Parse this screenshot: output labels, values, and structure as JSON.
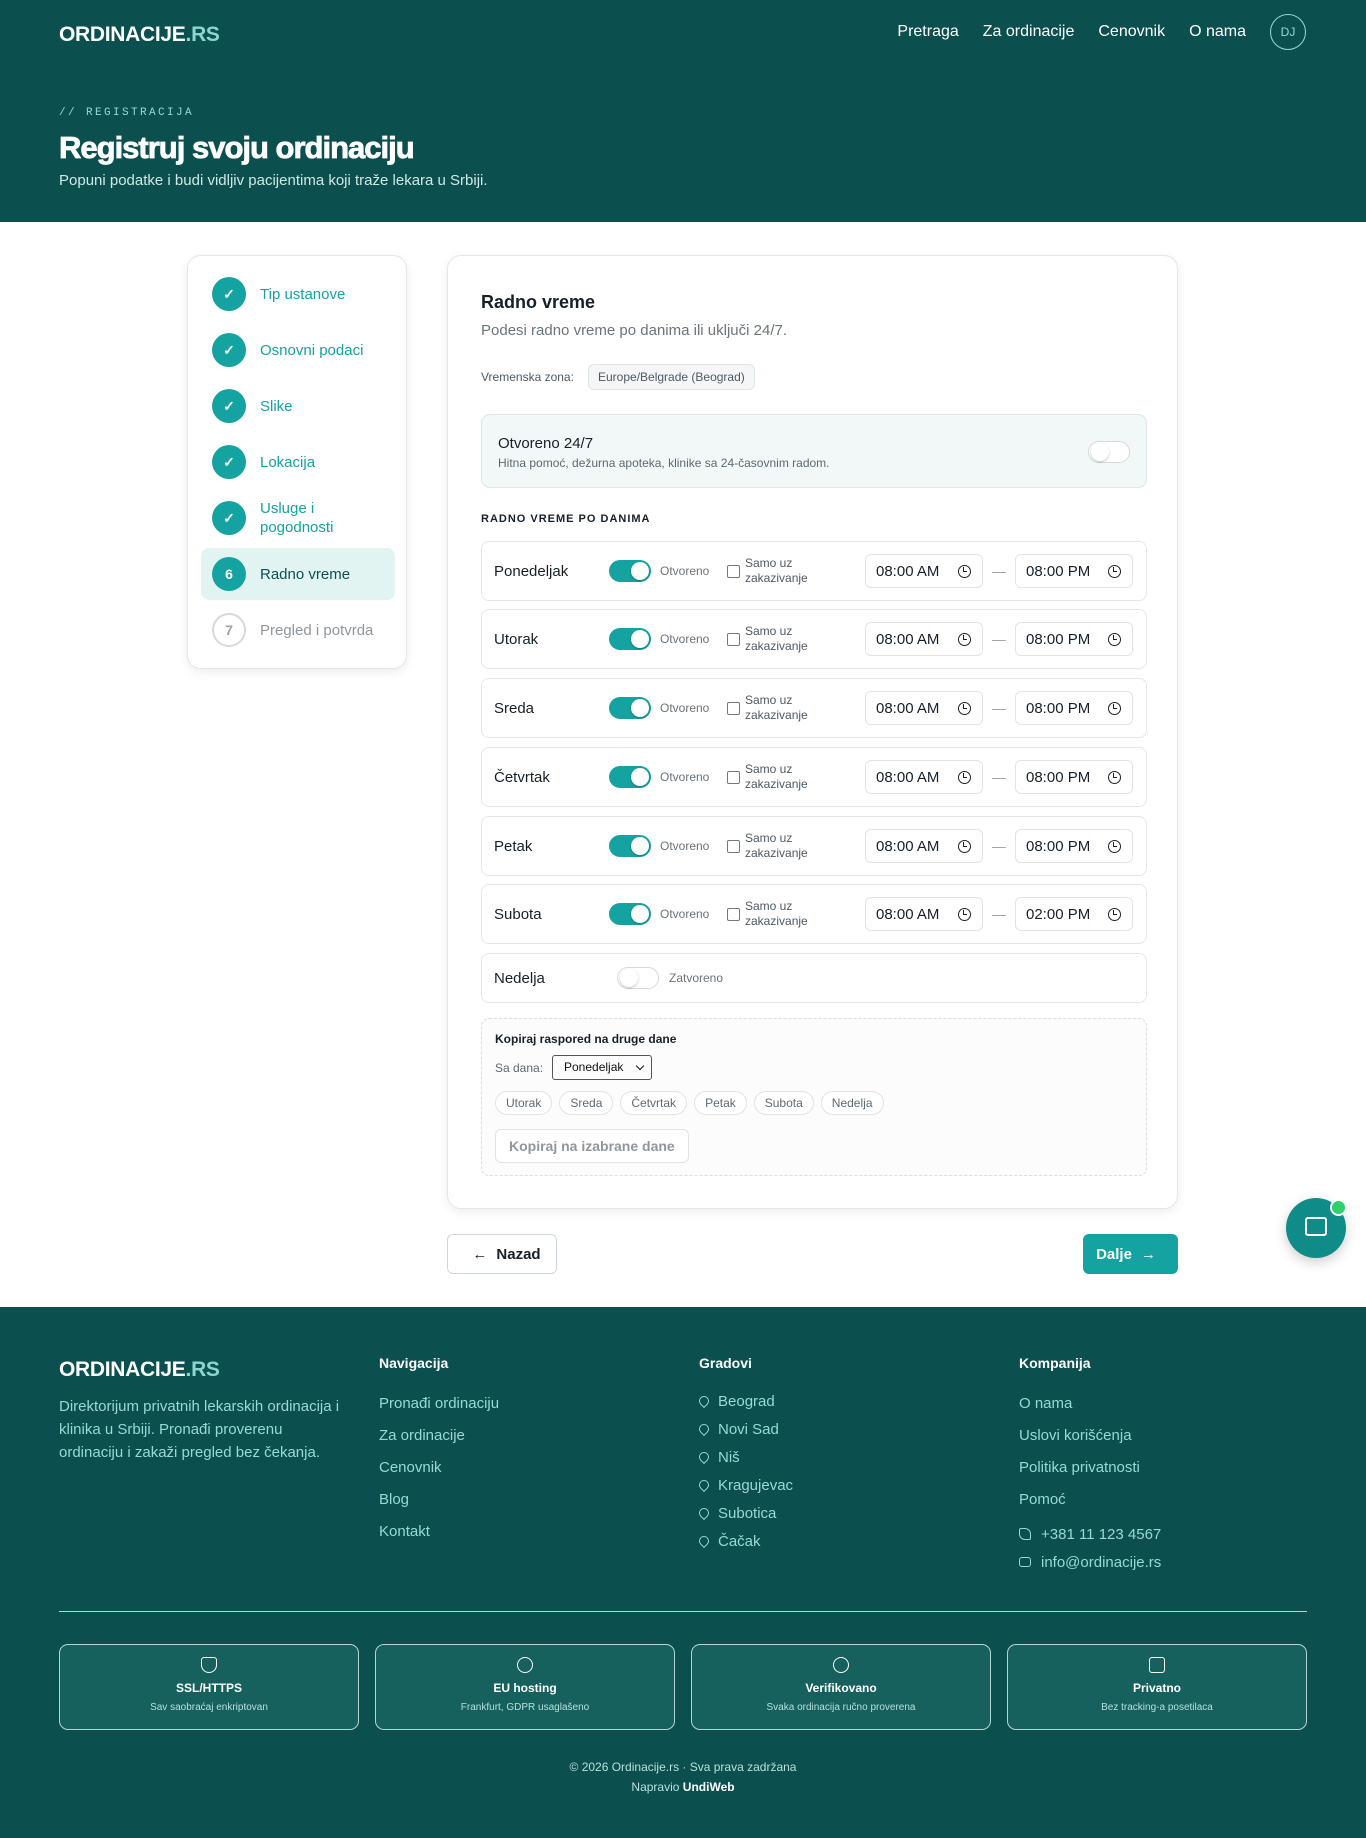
{
  "brand": {
    "name": "ORDINACIJE",
    "suffix": ".RS"
  },
  "nav": {
    "items": [
      "Pretraga",
      "Za ordinacije",
      "Cenovnik",
      "O nama"
    ],
    "avatar": "DJ"
  },
  "hero": {
    "kicker": "// REGISTRACIJA",
    "title": "Registruj svoju ordinaciju",
    "subtitle": "Popuni podatke i budi vidljiv pacijentima koji traže lekara u Srbiji."
  },
  "steps": [
    {
      "label": "Tip ustanove",
      "status": "done",
      "marker": "✓"
    },
    {
      "label": "Osnovni podaci",
      "status": "done",
      "marker": "✓"
    },
    {
      "label": "Slike",
      "status": "done",
      "marker": "✓"
    },
    {
      "label": "Lokacija",
      "status": "done",
      "marker": "✓"
    },
    {
      "label": "Usluge i pogodnosti",
      "status": "done",
      "marker": "✓"
    },
    {
      "label": "Radno vreme",
      "status": "active",
      "marker": "6"
    },
    {
      "label": "Pregled i potvrda",
      "status": "pending",
      "marker": "7"
    }
  ],
  "form": {
    "title": "Radno vreme",
    "subtitle": "Podesi radno vreme po danima ili uključi 24/7.",
    "timezone_label": "Vremenska zona:",
    "timezone_value": "Europe/Belgrade (Beograd)",
    "open247": {
      "title": "Otvoreno 24/7",
      "desc": "Hitna pomoć, dežurna apoteka, klinike sa 24-časovnim radom.",
      "enabled": false
    },
    "section_title": "RADNO VREME PO DANIMA",
    "open_label": "Otvoreno",
    "closed_label": "Zatvoreno",
    "appointment_label": "Samo uz zakazivanje",
    "days": [
      {
        "name": "Ponedeljak",
        "open": true,
        "from": "08:00 AM",
        "to": "08:00 PM"
      },
      {
        "name": "Utorak",
        "open": true,
        "from": "08:00 AM",
        "to": "08:00 PM"
      },
      {
        "name": "Sreda",
        "open": true,
        "from": "08:00 AM",
        "to": "08:00 PM"
      },
      {
        "name": "Četvrtak",
        "open": true,
        "from": "08:00 AM",
        "to": "08:00 PM"
      },
      {
        "name": "Petak",
        "open": true,
        "from": "08:00 AM",
        "to": "08:00 PM"
      },
      {
        "name": "Subota",
        "open": true,
        "from": "08:00 AM",
        "to": "02:00 PM"
      },
      {
        "name": "Nedelja",
        "open": false
      }
    ],
    "copy": {
      "title": "Kopiraj raspored na druge dane",
      "from_label": "Sa dana:",
      "from_value": "Ponedeljak",
      "targets": [
        "Utorak",
        "Sreda",
        "Četvrtak",
        "Petak",
        "Subota",
        "Nedelja"
      ],
      "button": "Kopiraj na izabrane dane"
    }
  },
  "actions": {
    "back": "Nazad",
    "next": "Dalje"
  },
  "footer": {
    "description": "Direktorijum privatnih lekarskih ordinacija i klinika u Srbiji. Pronađi proverenu ordinaciju i zakaži pregled bez čekanja.",
    "navigation": {
      "title": "Navigacija",
      "links": [
        "Pronađi ordinaciju",
        "Za ordinacije",
        "Cenovnik",
        "Blog",
        "Kontakt"
      ]
    },
    "cities": {
      "title": "Gradovi",
      "links": [
        "Beograd",
        "Novi Sad",
        "Niš",
        "Kragujevac",
        "Subotica",
        "Čačak"
      ]
    },
    "company": {
      "title": "Kompanija",
      "links": [
        "O nama",
        "Uslovi korišćenja",
        "Politika privatnosti",
        "Pomoć"
      ],
      "phone": "+381 11 123 4567",
      "email": "info@ordinacije.rs"
    },
    "badges": [
      {
        "title": "SSL/HTTPS",
        "desc": "Sav saobraćaj enkriptovan",
        "icon": "shield-icon"
      },
      {
        "title": "EU hosting",
        "desc": "Frankfurt, GDPR usaglašeno",
        "icon": "globe-icon"
      },
      {
        "title": "Verifikovano",
        "desc": "Svaka ordinacija ručno proverena",
        "icon": "check-circle-icon"
      },
      {
        "title": "Privatno",
        "desc": "Bez tracking-a posetilaca",
        "icon": "lock-icon"
      }
    ],
    "copyright": "© 2026 Ordinacije.rs · Sva prava zadržana",
    "made_by_prefix": "Napravio",
    "made_by": "UndiWeb"
  },
  "colors": {
    "brand_dark": "#0c4f4f",
    "accent": "#14a3a0",
    "online": "#2fd06b"
  }
}
